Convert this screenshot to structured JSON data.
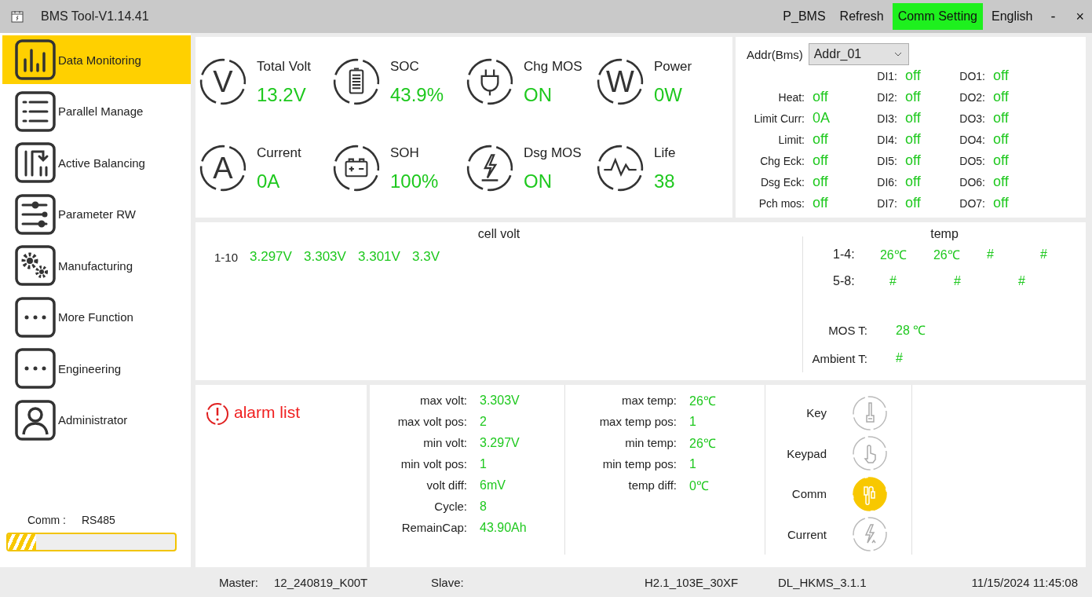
{
  "window": {
    "title": "BMS Tool-V1.14.41",
    "menu": [
      {
        "label": "P_BMS",
        "selected": false
      },
      {
        "label": "Refresh",
        "selected": false
      },
      {
        "label": "Comm Setting",
        "selected": true
      },
      {
        "label": "English",
        "selected": false
      }
    ],
    "minimize": "-",
    "close": "×"
  },
  "sidebar": {
    "items": [
      {
        "label": "Data Monitoring",
        "selected": true
      },
      {
        "label": "Parallel Manage",
        "selected": false
      },
      {
        "label": "Active Balancing",
        "selected": false
      },
      {
        "label": "Parameter RW",
        "selected": false
      },
      {
        "label": "Manufacturing",
        "selected": false
      },
      {
        "label": "More Function",
        "selected": false
      },
      {
        "label": "Engineering",
        "selected": false
      },
      {
        "label": "Administrator",
        "selected": false
      }
    ],
    "comm_label": "Comm :",
    "comm_value": "RS485",
    "comm_progress": {
      "level": 0.17
    }
  },
  "metrics": [
    {
      "label": "Total Volt",
      "value": "13.2V",
      "symbol": "V"
    },
    {
      "label": "SOC",
      "value": "43.9%"
    },
    {
      "label": "Chg MOS",
      "value": "ON"
    },
    {
      "label": "Power",
      "value": "0W",
      "symbol": "W"
    },
    {
      "label": "Current",
      "value": "0A",
      "symbol": "A"
    },
    {
      "label": "SOH",
      "value": "100%"
    },
    {
      "label": "Dsg MOS",
      "value": "ON"
    },
    {
      "label": "Life",
      "value": "38"
    }
  ],
  "status": {
    "addr_label": "Addr(Bms)",
    "addr_value": "Addr_01",
    "flags": [
      {
        "label": "Heat:",
        "value": "off"
      },
      {
        "label": "Limit Curr:",
        "value": "0A"
      },
      {
        "label": "Limit:",
        "value": "off"
      },
      {
        "label": "Chg Eck:",
        "value": "off"
      },
      {
        "label": "Dsg Eck:",
        "value": "off"
      },
      {
        "label": "Pch mos:",
        "value": "off"
      }
    ],
    "di": [
      {
        "label": "DI1:",
        "value": "off"
      },
      {
        "label": "DI2:",
        "value": "off"
      },
      {
        "label": "DI3:",
        "value": "off"
      },
      {
        "label": "DI4:",
        "value": "off"
      },
      {
        "label": "DI5:",
        "value": "off"
      },
      {
        "label": "DI6:",
        "value": "off"
      },
      {
        "label": "DI7:",
        "value": "off"
      }
    ],
    "do": [
      {
        "label": "DO1:",
        "value": "off"
      },
      {
        "label": "DO2:",
        "value": "off"
      },
      {
        "label": "DO3:",
        "value": "off"
      },
      {
        "label": "DO4:",
        "value": "off"
      },
      {
        "label": "DO5:",
        "value": "off"
      },
      {
        "label": "DO6:",
        "value": "off"
      },
      {
        "label": "DO7:",
        "value": "off"
      }
    ]
  },
  "cell_volt": {
    "title": "cell volt",
    "rows": [
      {
        "label": "1-10",
        "values": [
          "3.297V",
          "3.303V",
          "3.301V",
          "3.3V"
        ]
      }
    ]
  },
  "temp": {
    "title": "temp",
    "rows": [
      {
        "label": "1-4:",
        "values": [
          "26℃",
          "26℃",
          "#",
          "#"
        ]
      },
      {
        "label": "5-8:",
        "values": [
          "#",
          "#",
          "#"
        ]
      }
    ],
    "mos_label": "MOS T:",
    "mos_value": "28 ℃",
    "ambient_label": "Ambient T:",
    "ambient_value": "#"
  },
  "alarm": {
    "label": "alarm list"
  },
  "stats_volt": [
    {
      "label": "max volt:",
      "value": "3.303V"
    },
    {
      "label": "max volt pos:",
      "value": "2"
    },
    {
      "label": "min volt:",
      "value": "3.297V"
    },
    {
      "label": "min volt pos:",
      "value": "1"
    },
    {
      "label": "volt diff:",
      "value": "6mV"
    },
    {
      "label": "Cycle:",
      "value": "8"
    },
    {
      "label": "RemainCap:",
      "value": "43.90Ah"
    }
  ],
  "stats_temp": [
    {
      "label": "max temp:",
      "value": "26℃"
    },
    {
      "label": "max temp pos:",
      "value": "1"
    },
    {
      "label": "min temp:",
      "value": "26℃"
    },
    {
      "label": "min temp pos:",
      "value": "1"
    },
    {
      "label": "temp diff:",
      "value": "0℃"
    }
  ],
  "indicators": [
    {
      "label": "Key",
      "on": false
    },
    {
      "label": "Keypad",
      "on": false
    },
    {
      "label": "Comm",
      "on": true
    },
    {
      "label": "Current",
      "on": false
    }
  ],
  "status_bar": {
    "master_label": "Master:",
    "master_value": "12_240819_K00T",
    "slave_label": "Slave:",
    "hardware": "H2.1_103E_30XF",
    "software": "DL_HKMS_3.1.1",
    "datetime": "11/15/2024 11:45:08"
  }
}
